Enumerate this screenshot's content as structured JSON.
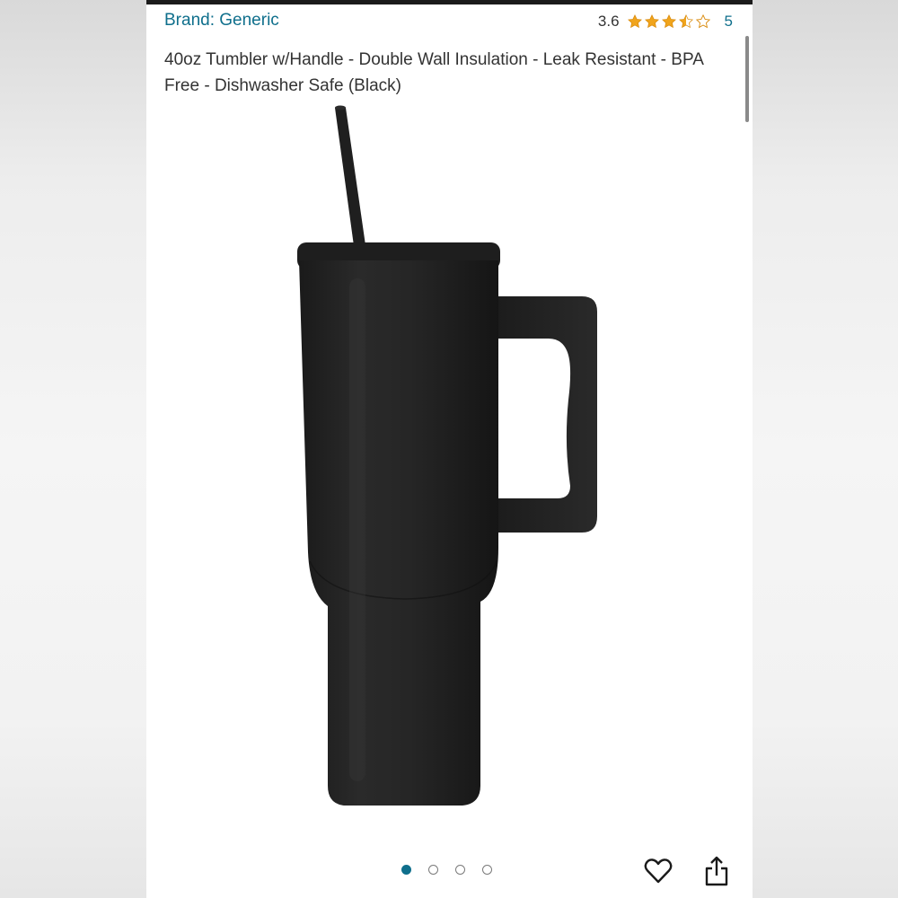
{
  "header": {
    "brand": "Brand: Generic",
    "rating_value": "3.6",
    "rating": 3.6,
    "rating_max": 5,
    "rating_count": "5"
  },
  "product": {
    "title": "40oz Tumbler w/Handle - Double Wall Insulation - Leak Resistant - BPA Free - Dishwasher Safe (Black)",
    "image": "black-tumbler-with-handle-and-straw"
  },
  "carousel": {
    "total": 4,
    "active_index": 0
  },
  "actions": {
    "favorite_icon": "heart-icon",
    "share_icon": "share-icon"
  },
  "colors": {
    "link": "#0f6f8c",
    "star": "#f0a41c",
    "text": "#333333"
  }
}
